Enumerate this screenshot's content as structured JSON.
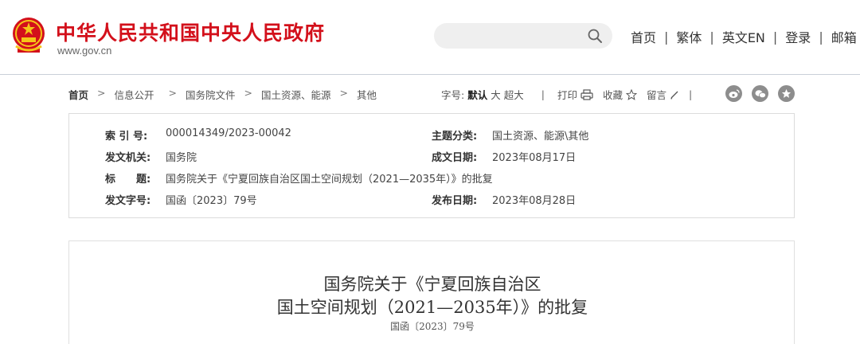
{
  "header": {
    "site_title": "中华人民共和国中央人民政府",
    "site_domain": "www.gov.cn",
    "emblem_icon": "national-emblem-icon",
    "search": {
      "placeholder": "",
      "icon": "search-icon"
    },
    "nav": [
      "首页",
      "繁体",
      "英文EN",
      "登录",
      "邮箱"
    ],
    "brand_color": "#d3101b"
  },
  "breadcrumb": [
    "首页",
    "信息公开",
    "国务院文件",
    "国土资源、能源",
    "其他"
  ],
  "tools": {
    "font_size_label": "字号:",
    "font_sizes": [
      "默认",
      "大",
      "超大"
    ],
    "active_font_size": "默认",
    "print": "打印",
    "favorite": "收藏",
    "comment": "留言",
    "social_icons": [
      "weibo-icon",
      "wechat-icon",
      "star-icon"
    ]
  },
  "info": {
    "index_label": "索 引 号:",
    "index_value": "000014349/2023-00042",
    "category_label": "主题分类:",
    "category_value": "国土资源、能源\\其他",
    "issuer_label": "发文机关:",
    "issuer_value": "国务院",
    "date_written_label": "成文日期:",
    "date_written_value": "2023年08月17日",
    "title_label": "标　　题:",
    "title_value": "国务院关于《宁夏回族自治区国土空间规划（2021—2035年）》的批复",
    "doc_no_label": "发文字号:",
    "doc_no_value": "国函〔2023〕79号",
    "publish_label": "发布日期:",
    "publish_value": "2023年08月28日"
  },
  "article": {
    "title_line1": "国务院关于《宁夏回族自治区",
    "title_line2": "国土空间规划（2021—2035年）》的批复",
    "doc_number": "国函〔2023〕79号"
  }
}
